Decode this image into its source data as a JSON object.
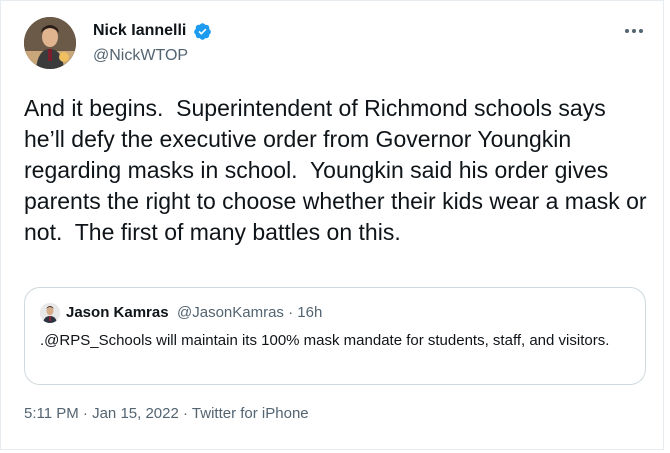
{
  "author": {
    "name": "Nick Iannelli",
    "handle": "@NickWTOP"
  },
  "icons": {
    "verified": "verified-badge-icon",
    "more": "more-options-icon"
  },
  "tweet": {
    "text": "And it begins.  Superintendent of Richmond schools says he’ll defy the executive order from Governor Youngkin regarding masks in school.  Youngkin said his order gives parents the right to choose whether their kids wear a mask or not.  The first of many battles on this."
  },
  "quote": {
    "name": "Jason Kamras",
    "meta": "@JasonKamras · 16h",
    "text": ".@RPS_Schools will maintain its 100% mask mandate for students, staff, and visitors."
  },
  "footer": {
    "time": "5:11 PM",
    "sep1": " · ",
    "date": "Jan 15, 2022",
    "sep2": " · ",
    "source": "Twitter for iPhone"
  },
  "colors": {
    "verified": "#1d9bf0",
    "text": "#0f1419",
    "secondary": "#536471",
    "border": "#cfd9de"
  }
}
